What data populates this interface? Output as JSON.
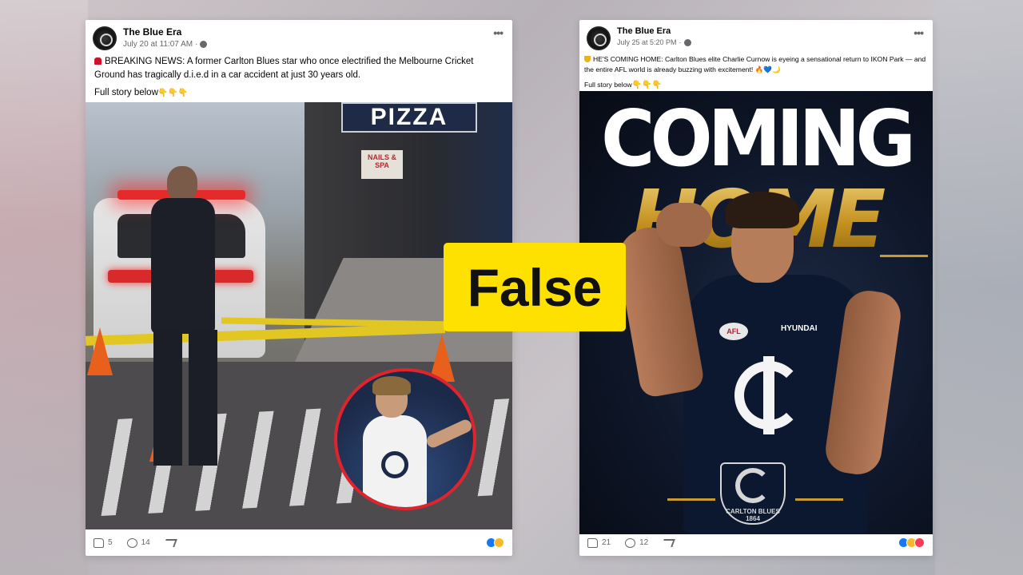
{
  "colors": {
    "badge_bg": "#ffe100",
    "badge_text": "#111111",
    "post_bg": "#ffffff",
    "carlton_navy": "#0c1730",
    "gold": "#c99a2d",
    "alert_red": "#e0242d"
  },
  "verdict": {
    "label": "False"
  },
  "posts": [
    {
      "page_name": "The Blue Era",
      "timestamp": "July 20 at 11:07 AM",
      "privacy_icon": "globe-icon",
      "text_lead_icon": "siren-icon",
      "text": "BREAKING NEWS: A former Carlton Blues star who once electrified the Melbourne Cricket Ground has tragically d.i.e.d in a car accident at just 30 years old.",
      "cta": "Full story below",
      "cta_emoji": "👇👇👇",
      "image_signs": {
        "pizza": "PIZZA",
        "nails": "NAILS & SPA"
      },
      "likes": "5",
      "comments": "14",
      "reactions": [
        "like",
        "wow"
      ]
    },
    {
      "page_name": "The Blue Era",
      "timestamp": "July 25 at 5:20 PM",
      "privacy_icon": "globe-icon",
      "text_lead_icon": "trophy-icon",
      "text": "HE'S COMING HOME: Carlton Blues elite Charlie Curnow is eyeing a sensational return to IKON Park — and the entire AFL world is already buzzing with excitement! 🔥💙🌙",
      "cta": "Full story below",
      "cta_emoji": "👇👇👇",
      "image_headline_1": "COMING",
      "image_headline_2": "HOME",
      "jersey_badge": "AFL",
      "jersey_sponsor": "HYUNDAI",
      "club_name": "CARLTON BLUES",
      "club_year": "1864",
      "likes": "21",
      "comments": "12",
      "reactions": [
        "like",
        "haha",
        "love"
      ]
    }
  ]
}
